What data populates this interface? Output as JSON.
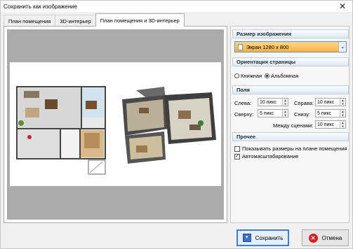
{
  "window": {
    "title": "Сохранить как изображение",
    "close": "✕"
  },
  "tabs": [
    {
      "label": "План помещения"
    },
    {
      "label": "3D-интерьер"
    },
    {
      "label": "План помещения и 3D-интерьер"
    }
  ],
  "size": {
    "header": "Размер изображения",
    "selected": "Экран 1280 x 800",
    "arrow": "⌄"
  },
  "orientation": {
    "header": "Ориентация страницы",
    "portrait": "Книжная",
    "landscape": "Альбомная"
  },
  "margins": {
    "header": "Поля",
    "left_label": "Слева:",
    "left_value": "10 пикс",
    "right_label": "Справа:",
    "right_value": "10 пикс",
    "top_label": "Сверху:",
    "top_value": "5 пикс",
    "bottom_label": "Снизу:",
    "bottom_value": "5 пикс",
    "gap_label": "Между сценами:",
    "gap_value": "10 пикс",
    "up": "▲",
    "down": "▼"
  },
  "other": {
    "header": "Прочее",
    "show_sizes": "Показывать размеры на плане помещения",
    "autoscale": "Автомасштабирование",
    "check": "✓"
  },
  "buttons": {
    "save": "Сохранить",
    "cancel": "Отмена",
    "save_icon": "▾",
    "cancel_icon": "✕"
  }
}
